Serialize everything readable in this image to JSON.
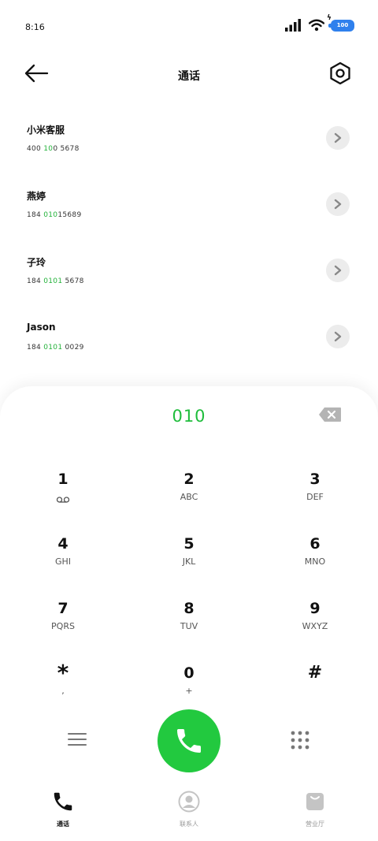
{
  "status_bar": {
    "time": "8:16",
    "battery": "100"
  },
  "header": {
    "title": "通话"
  },
  "recent_calls": [
    {
      "name": "小米客服",
      "number_before": "400 ",
      "number_highlight": "10",
      "number_after": "0 5678"
    },
    {
      "name": "燕婷",
      "number_before": "184 ",
      "number_highlight": "010",
      "number_after": "15689"
    },
    {
      "name": "子玲",
      "number_before": "184 ",
      "number_highlight": "0101",
      "number_after": " 5678"
    },
    {
      "name": "Jason",
      "number_before": "184 ",
      "number_highlight": "0101",
      "number_after": " 0029"
    }
  ],
  "dialer": {
    "input": "010",
    "keys": [
      [
        {
          "digit": "1",
          "sub": "",
          "icon": "voicemail-icon"
        },
        {
          "digit": "2",
          "sub": "ABC"
        },
        {
          "digit": "3",
          "sub": "DEF"
        }
      ],
      [
        {
          "digit": "4",
          "sub": "GHI"
        },
        {
          "digit": "5",
          "sub": "JKL"
        },
        {
          "digit": "6",
          "sub": "MNO"
        }
      ],
      [
        {
          "digit": "7",
          "sub": "PQRS"
        },
        {
          "digit": "8",
          "sub": "TUV"
        },
        {
          "digit": "9",
          "sub": "WXYZ"
        }
      ],
      [
        {
          "digit": "*",
          "sub": ","
        },
        {
          "digit": "0",
          "sub": "+"
        },
        {
          "digit": "#",
          "sub": ""
        }
      ]
    ]
  },
  "tabs": [
    {
      "label": "通话",
      "icon": "phone-icon",
      "active": true
    },
    {
      "label": "联系人",
      "icon": "contact-icon",
      "active": false
    },
    {
      "label": "营业厅",
      "icon": "store-bag-icon",
      "active": false
    }
  ],
  "colors": {
    "accent_green": "#22c93f",
    "highlight_green": "#23b23a",
    "battery_blue": "#2f80ed"
  }
}
